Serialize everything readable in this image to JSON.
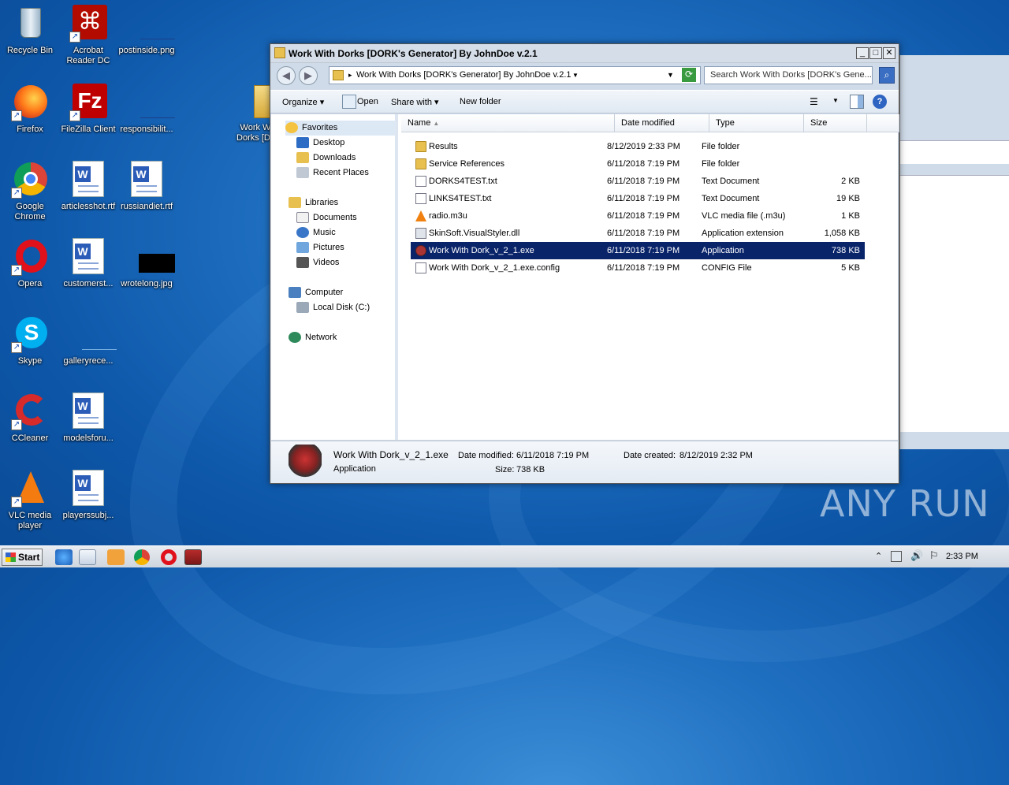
{
  "desktop": {
    "icons": [
      {
        "label": "Recycle Bin"
      },
      {
        "label": "Acrobat Reader DC"
      },
      {
        "label": "postinside.png"
      },
      {
        "label": "Firefox"
      },
      {
        "label": "FileZilla Client"
      },
      {
        "label": "responsibilit..."
      },
      {
        "label": "Work W... Dorks [D..."
      },
      {
        "label": "Google Chrome"
      },
      {
        "label": "articlesshot.rtf"
      },
      {
        "label": "russiandiet.rtf"
      },
      {
        "label": "Opera"
      },
      {
        "label": "customerst..."
      },
      {
        "label": "wrotelong.jpg"
      },
      {
        "label": "Skype"
      },
      {
        "label": "galleryrece..."
      },
      {
        "label": "CCleaner"
      },
      {
        "label": "modelsforu..."
      },
      {
        "label": "VLC media player"
      },
      {
        "label": "playerssubj..."
      }
    ]
  },
  "window": {
    "title": "Work With Dorks [DORK's Generator] By JohnDoe v.2.1",
    "address": "Work With Dorks [DORK's Generator] By JohnDoe v.2.1",
    "search_placeholder": "Search Work With Dorks [DORK's Gene...",
    "toolbar": {
      "organize": "Organize",
      "open": "Open",
      "share_with": "Share with",
      "new_folder": "New folder"
    },
    "nav": {
      "favorites": "Favorites",
      "desktop": "Desktop",
      "downloads": "Downloads",
      "recent": "Recent Places",
      "libraries": "Libraries",
      "documents": "Documents",
      "music": "Music",
      "pictures": "Pictures",
      "videos": "Videos",
      "computer": "Computer",
      "local_disk": "Local Disk (C:)",
      "network": "Network"
    },
    "columns": {
      "name": "Name",
      "date": "Date modified",
      "type": "Type",
      "size": "Size"
    },
    "files": [
      {
        "name": "Results",
        "date": "8/12/2019 2:33 PM",
        "type": "File folder",
        "size": "",
        "icon": "folder-icon"
      },
      {
        "name": "Service References",
        "date": "6/11/2018 7:19 PM",
        "type": "File folder",
        "size": "",
        "icon": "folder-icon"
      },
      {
        "name": "DORKS4TEST.txt",
        "date": "6/11/2018 7:19 PM",
        "type": "Text Document",
        "size": "2 KB",
        "icon": "text-file-icon"
      },
      {
        "name": "LINKS4TEST.txt",
        "date": "6/11/2018 7:19 PM",
        "type": "Text Document",
        "size": "19 KB",
        "icon": "text-file-icon"
      },
      {
        "name": "radio.m3u",
        "date": "6/11/2018 7:19 PM",
        "type": "VLC media file (.m3u)",
        "size": "1 KB",
        "icon": "vlc-icon"
      },
      {
        "name": "SkinSoft.VisualStyler.dll",
        "date": "6/11/2018 7:19 PM",
        "type": "Application extension",
        "size": "1,058 KB",
        "icon": "dll-icon"
      },
      {
        "name": "Work With Dork_v_2_1.exe",
        "date": "6/11/2018 7:19 PM",
        "type": "Application",
        "size": "738 KB",
        "icon": "exe-icon"
      },
      {
        "name": "Work With Dork_v_2_1.exe.config",
        "date": "6/11/2018 7:19 PM",
        "type": "CONFIG File",
        "size": "5 KB",
        "icon": "config-icon"
      }
    ],
    "details": {
      "name": "Work With Dork_v_2_1.exe",
      "modified_label": "Date modified:",
      "modified": "6/11/2018 7:19 PM",
      "created_label": "Date created:",
      "created": "8/12/2019 2:32 PM",
      "type": "Application",
      "size_label": "Size:",
      "size": "738 KB"
    }
  },
  "taskbar": {
    "start": "Start",
    "clock": "2:33 PM"
  },
  "watermark": "ANY RUN"
}
